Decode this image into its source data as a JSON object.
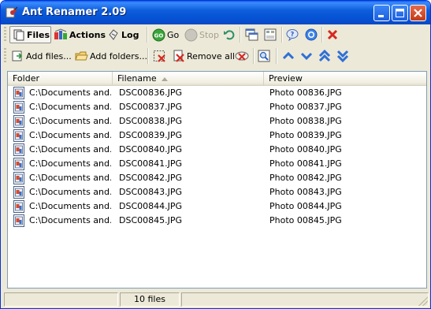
{
  "window": {
    "title": "Ant Renamer 2.09"
  },
  "toolbar1": {
    "files_label": "Files",
    "actions_label": "Actions",
    "log_label": "Log",
    "go_label": "Go",
    "stop_label": "Stop"
  },
  "toolbar2": {
    "add_files_label": "Add files...",
    "add_folders_label": "Add folders...",
    "remove_all_label": "Remove all"
  },
  "list": {
    "columns": [
      "Folder",
      "Filename",
      "Preview"
    ],
    "sorted_column": "Filename",
    "rows": [
      {
        "folder": "C:\\Documents and...",
        "filename": "DSC00836.JPG",
        "preview": "Photo 00836.JPG"
      },
      {
        "folder": "C:\\Documents and...",
        "filename": "DSC00837.JPG",
        "preview": "Photo 00837.JPG"
      },
      {
        "folder": "C:\\Documents and...",
        "filename": "DSC00838.JPG",
        "preview": "Photo 00838.JPG"
      },
      {
        "folder": "C:\\Documents and...",
        "filename": "DSC00839.JPG",
        "preview": "Photo 00839.JPG"
      },
      {
        "folder": "C:\\Documents and...",
        "filename": "DSC00840.JPG",
        "preview": "Photo 00840.JPG"
      },
      {
        "folder": "C:\\Documents and...",
        "filename": "DSC00841.JPG",
        "preview": "Photo 00841.JPG"
      },
      {
        "folder": "C:\\Documents and...",
        "filename": "DSC00842.JPG",
        "preview": "Photo 00842.JPG"
      },
      {
        "folder": "C:\\Documents and...",
        "filename": "DSC00843.JPG",
        "preview": "Photo 00843.JPG"
      },
      {
        "folder": "C:\\Documents and...",
        "filename": "DSC00844.JPG",
        "preview": "Photo 00844.JPG"
      },
      {
        "folder": "C:\\Documents and...",
        "filename": "DSC00845.JPG",
        "preview": "Photo 00845.JPG"
      }
    ]
  },
  "status": {
    "file_count": "10 files"
  },
  "icons": {
    "app": "ant-icon",
    "minimize": "minimize-icon",
    "maximize": "maximize-icon",
    "close": "close-icon"
  },
  "colors": {
    "titlebar": "#0a5fe8",
    "go_green": "#3aa53a",
    "arrow_blue": "#2f6fd6",
    "remove_red": "#d6281f"
  }
}
